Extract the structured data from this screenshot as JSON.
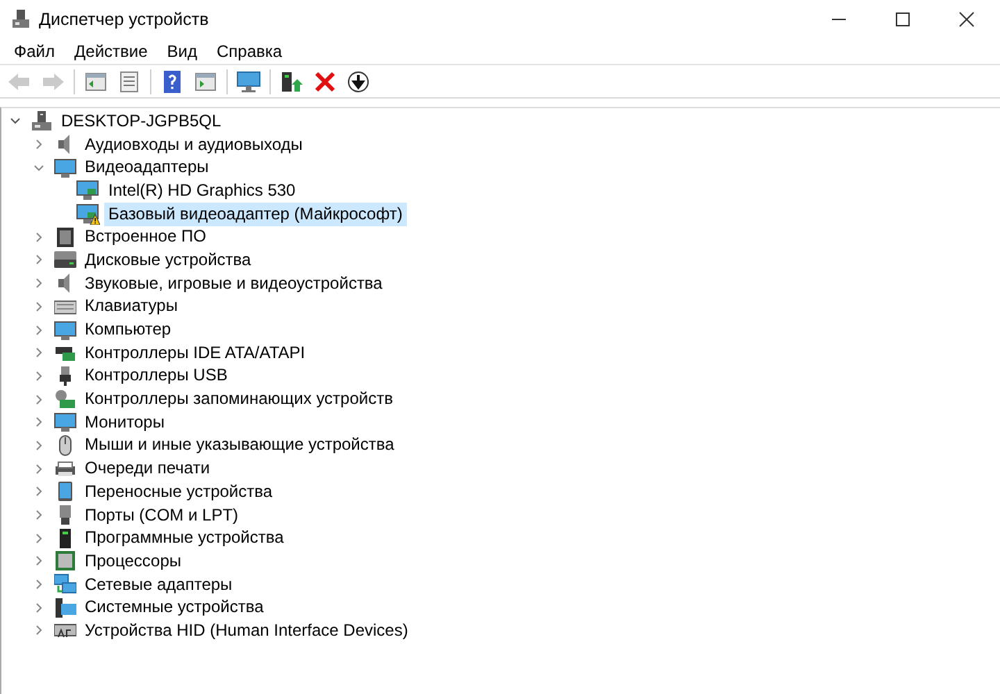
{
  "window": {
    "title": "Диспетчер устройств"
  },
  "menu": [
    "Файл",
    "Действие",
    "Вид",
    "Справка"
  ],
  "toolbar": [
    {
      "disabled": true
    },
    {
      "disabled": true
    },
    {
      "disabled": false
    },
    {
      "disabled": false
    },
    {
      "disabled": false
    },
    {
      "disabled": false
    },
    {
      "disabled": false
    },
    {
      "disabled": false
    },
    {
      "disabled": false
    },
    {
      "disabled": false
    }
  ],
  "tree": {
    "label": "DESKTOP-JGPB5QL",
    "expanded": true,
    "children": [
      {
        "label": "Аудиовходы и аудиовыходы",
        "expanded": false,
        "selected": false
      },
      {
        "label": "Видеоадаптеры",
        "expanded": true,
        "selected": false,
        "children": [
          {
            "label": "Intel(R) HD Graphics 530",
            "warning": false,
            "selected": false
          },
          {
            "label": "Базовый видеоадаптер (Майкрософт)",
            "warning": true,
            "selected": true
          }
        ]
      },
      {
        "label": "Встроенное ПО",
        "expanded": false,
        "selected": false
      },
      {
        "label": "Дисковые устройства",
        "expanded": false,
        "selected": false
      },
      {
        "label": "Звуковые, игровые и видеоустройства",
        "expanded": false,
        "selected": false
      },
      {
        "label": "Клавиатуры",
        "expanded": false,
        "selected": false
      },
      {
        "label": "Компьютер",
        "expanded": false,
        "selected": false
      },
      {
        "label": "Контроллеры IDE ATA/ATAPI",
        "expanded": false,
        "selected": false
      },
      {
        "label": "Контроллеры USB",
        "expanded": false,
        "selected": false
      },
      {
        "label": "Контроллеры запоминающих устройств",
        "expanded": false,
        "selected": false
      },
      {
        "label": "Мониторы",
        "expanded": false,
        "selected": false
      },
      {
        "label": "Мыши и иные указывающие устройства",
        "expanded": false,
        "selected": false
      },
      {
        "label": "Очереди печати",
        "expanded": false,
        "selected": false
      },
      {
        "label": "Переносные устройства",
        "expanded": false,
        "selected": false
      },
      {
        "label": "Порты (COM и LPT)",
        "expanded": false,
        "selected": false
      },
      {
        "label": "Программные устройства",
        "expanded": false,
        "selected": false
      },
      {
        "label": "Процессоры",
        "expanded": false,
        "selected": false
      },
      {
        "label": "Сетевые адаптеры",
        "expanded": false,
        "selected": false
      },
      {
        "label": "Системные устройства",
        "expanded": false,
        "selected": false
      },
      {
        "label": "Устройства HID (Human Interface Devices)",
        "expanded": false,
        "selected": false
      }
    ]
  }
}
